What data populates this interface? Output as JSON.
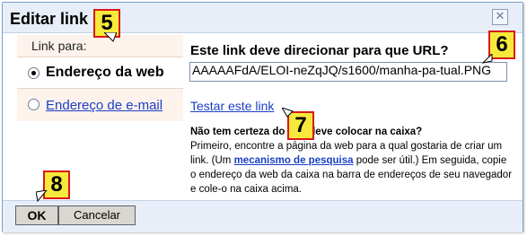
{
  "dialog": {
    "title": "Editar link",
    "close_icon": "close-icon"
  },
  "link_type": {
    "label": "Link para:",
    "options": [
      {
        "label": "Endereço da web",
        "selected": true
      },
      {
        "label": "Endereço de e-mail",
        "selected": false
      }
    ]
  },
  "url": {
    "heading": "Este link deve direcionar para que URL?",
    "value": "AAAAAFdA/ELOI-neZqJQ/s1600/manha-pa-tual.PNG",
    "test_link": "Testar este link"
  },
  "help": {
    "question": "Não tem certeza do que deve colocar na caixa?",
    "text_1": "Primeiro, encontre a página da web para a qual gostaria de criar um link. (Um",
    "search_link": "mecanismo de pesquisa",
    "text_2": "pode ser útil.) Em seguida, copie o endereço da web da caixa na barra de endereços de seu navegador e cole-o na caixa acima."
  },
  "buttons": {
    "ok": "OK",
    "cancel": "Cancelar"
  },
  "markers": [
    "5",
    "6",
    "7",
    "8"
  ],
  "colors": {
    "titlebar_bg": "#e8eef7",
    "link_blue": "#1a3fc4",
    "marker_fill": "#f7e93c",
    "marker_border": "#d81919",
    "panel_tint": "#fdf2ec"
  }
}
